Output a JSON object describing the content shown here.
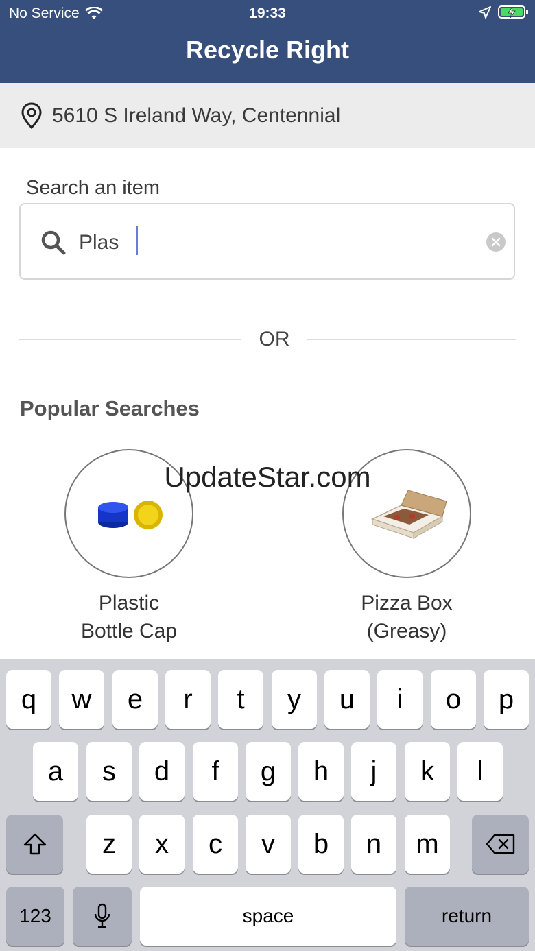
{
  "status_bar": {
    "carrier": "No Service",
    "time": "19:33"
  },
  "header": {
    "title": "Recycle Right"
  },
  "location": {
    "icon": "map-pin-icon",
    "address": "5610 S Ireland Way, Centennial"
  },
  "search": {
    "label": "Search an item",
    "value": "Plas"
  },
  "divider": {
    "text": "OR"
  },
  "popular": {
    "title": "Popular Searches",
    "items": [
      {
        "line1": "Plastic",
        "line2": "Bottle Cap"
      },
      {
        "line1": "Pizza Box",
        "line2": "(Greasy)"
      }
    ]
  },
  "watermark": "UpdateStar.com",
  "keyboard": {
    "row1": [
      "q",
      "w",
      "e",
      "r",
      "t",
      "y",
      "u",
      "i",
      "o",
      "p"
    ],
    "row2": [
      "a",
      "s",
      "d",
      "f",
      "g",
      "h",
      "j",
      "k",
      "l"
    ],
    "row3": [
      "z",
      "x",
      "c",
      "v",
      "b",
      "n",
      "m"
    ],
    "numbers_label": "123",
    "space_label": "space",
    "return_label": "return"
  },
  "colors": {
    "header_bg": "#374f7c",
    "location_bg": "#ececec",
    "keyboard_bg": "#d1d3d9",
    "cursor": "#6a7bdc"
  }
}
